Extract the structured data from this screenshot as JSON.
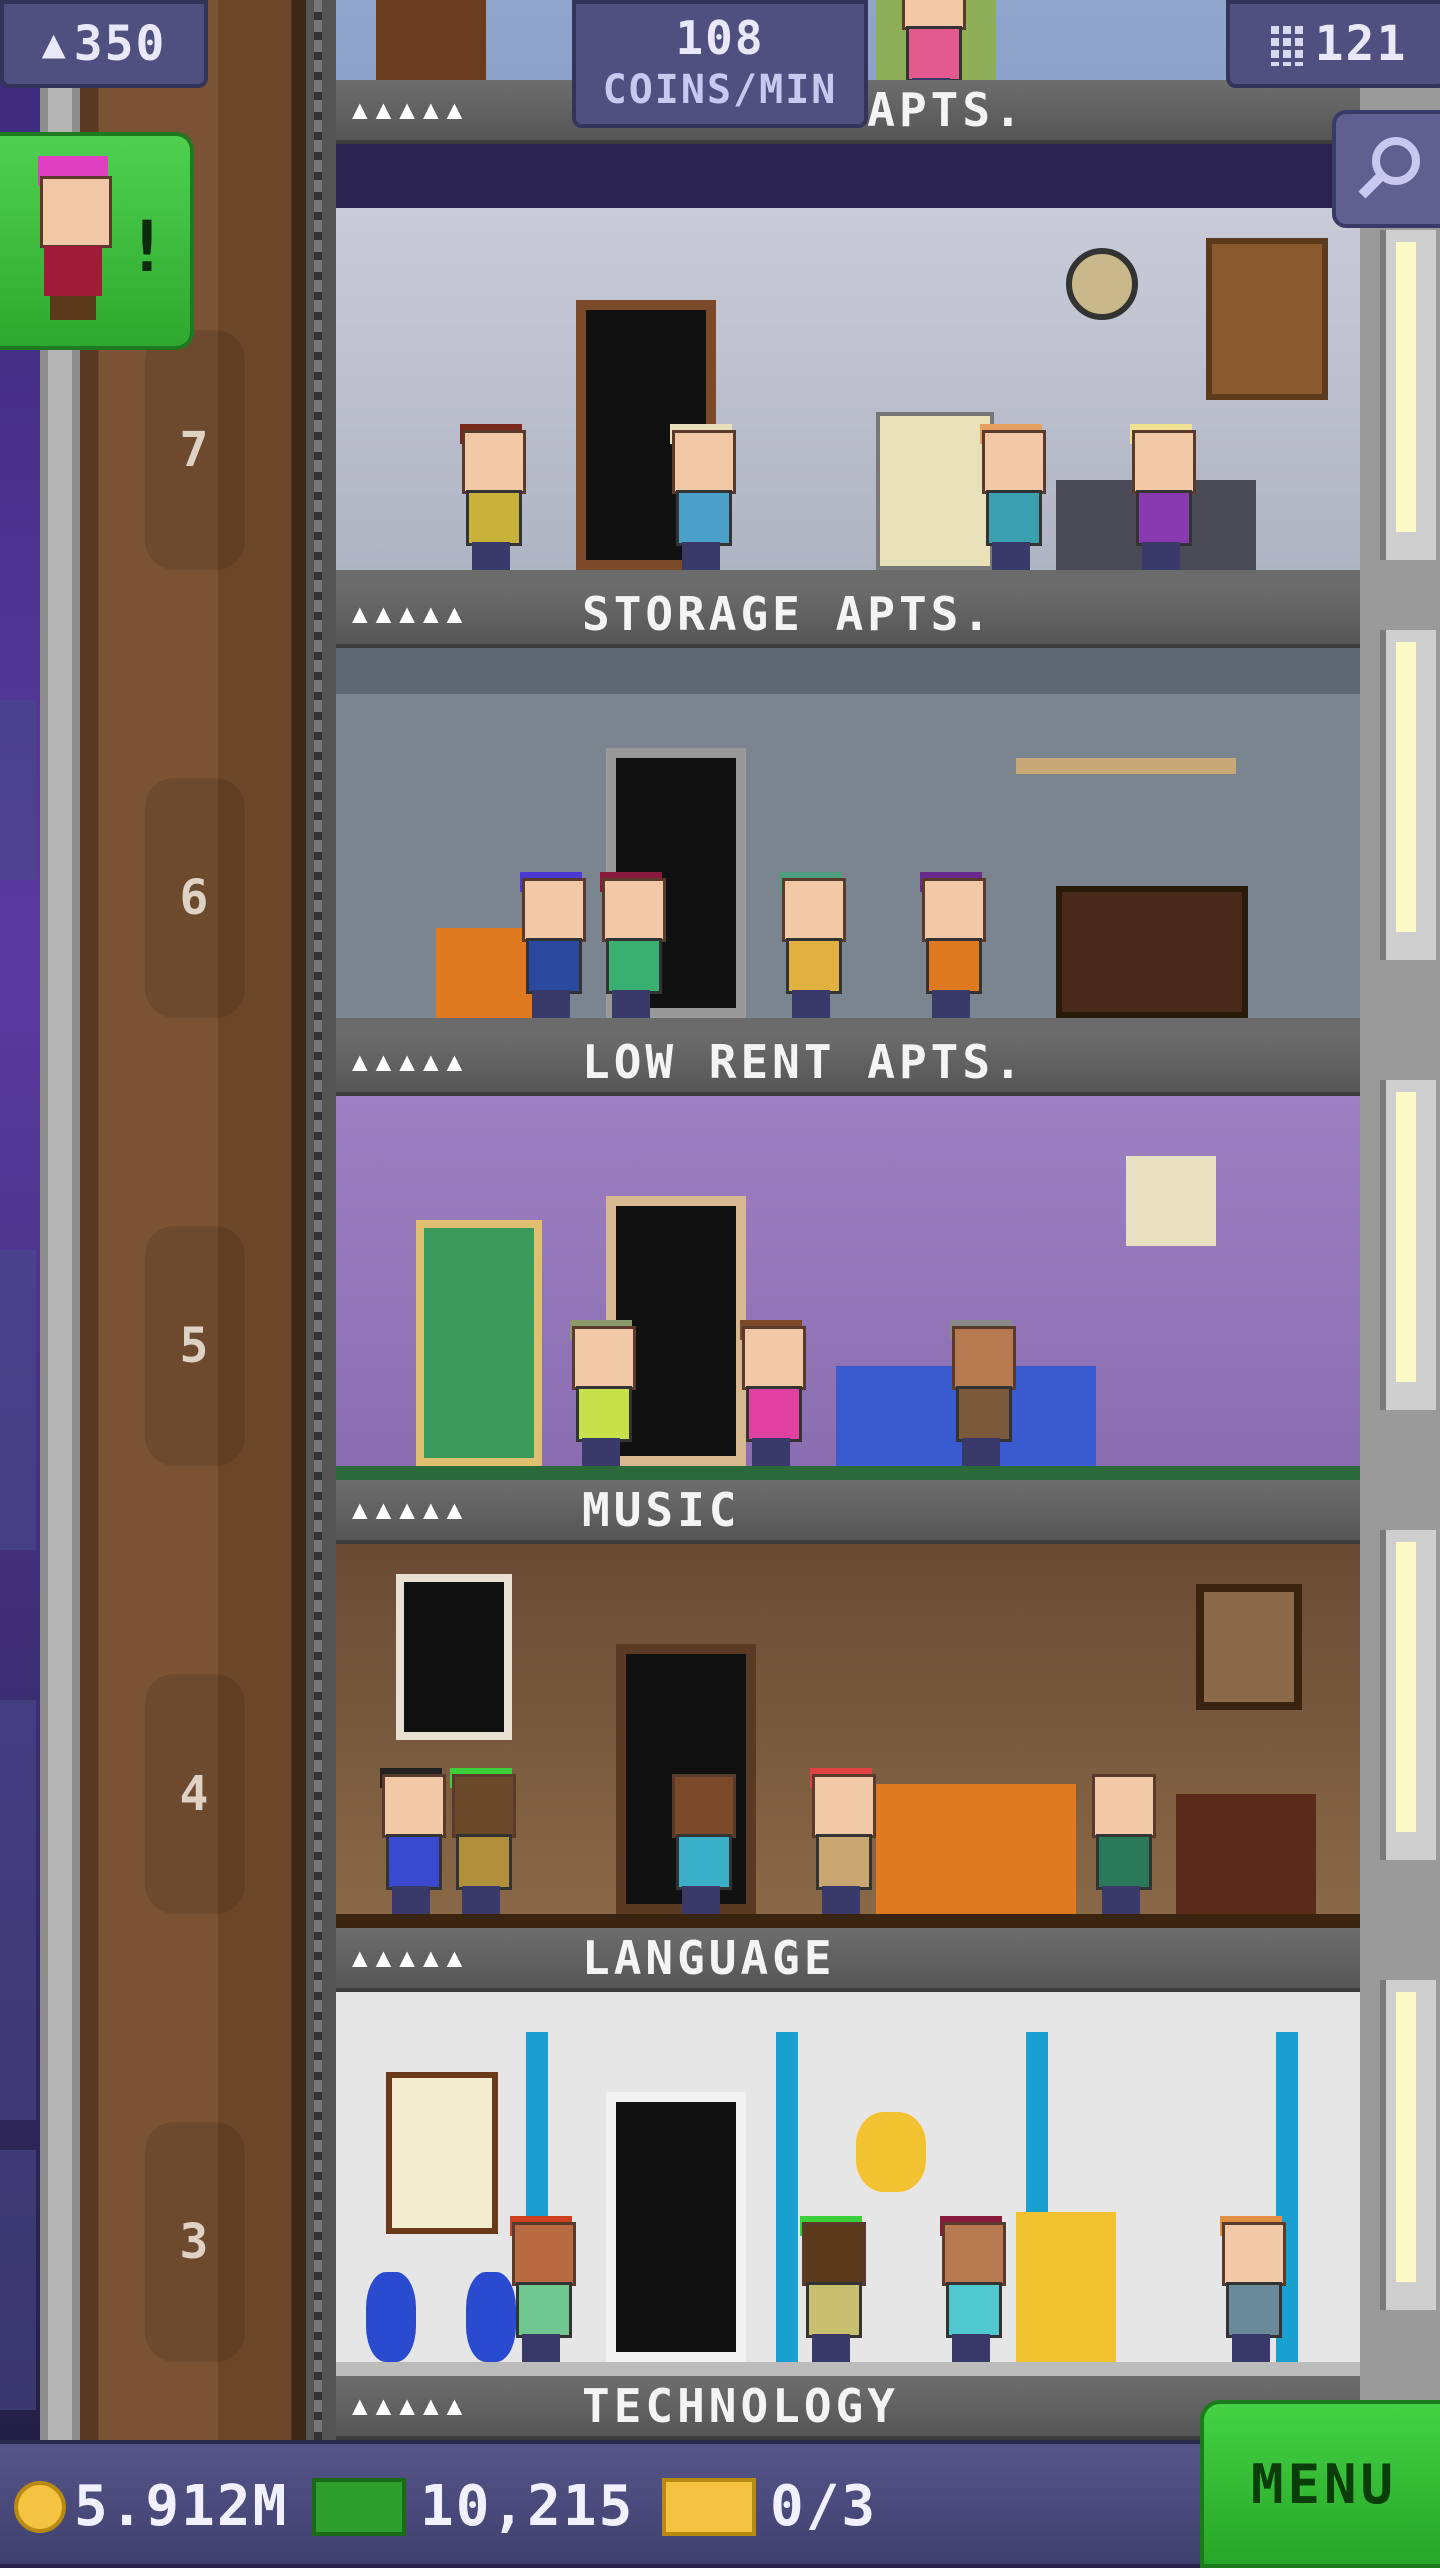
{
  "hud": {
    "population": "350",
    "coins_rate_value": "108",
    "coins_rate_unit": "COINS/MIN",
    "floor_count": "121"
  },
  "floors": [
    {
      "title": "BACHELOR APTS.",
      "stars": "▲▲▲▲▲",
      "number": "7"
    },
    {
      "title": "STORAGE APTS.",
      "stars": "▲▲▲▲▲",
      "number": "6"
    },
    {
      "title": "LOW RENT APTS.",
      "stars": "▲▲▲▲▲",
      "number": "5"
    },
    {
      "title": "MUSIC",
      "stars": "▲▲▲▲▲",
      "number": "4"
    },
    {
      "title": "LANGUAGE",
      "stars": "▲▲▲▲▲",
      "number": "3"
    },
    {
      "title": "TECHNOLOGY",
      "stars": "▲▲▲▲▲"
    }
  ],
  "alert": {
    "mark": "!"
  },
  "bottom": {
    "coins": "5.912M",
    "bux": "10,215",
    "tickets": "0/3",
    "menu_label": "MENU"
  },
  "colors": {
    "hud_bg": "#505080",
    "menu_green": "#33bb33",
    "coin_gold": "#f5c342",
    "bux_green": "#2e9e2e"
  },
  "icons": [
    "person-icon",
    "floor-building-icon",
    "search-icon",
    "coin-icon",
    "bux-icon",
    "ticket-icon"
  ]
}
